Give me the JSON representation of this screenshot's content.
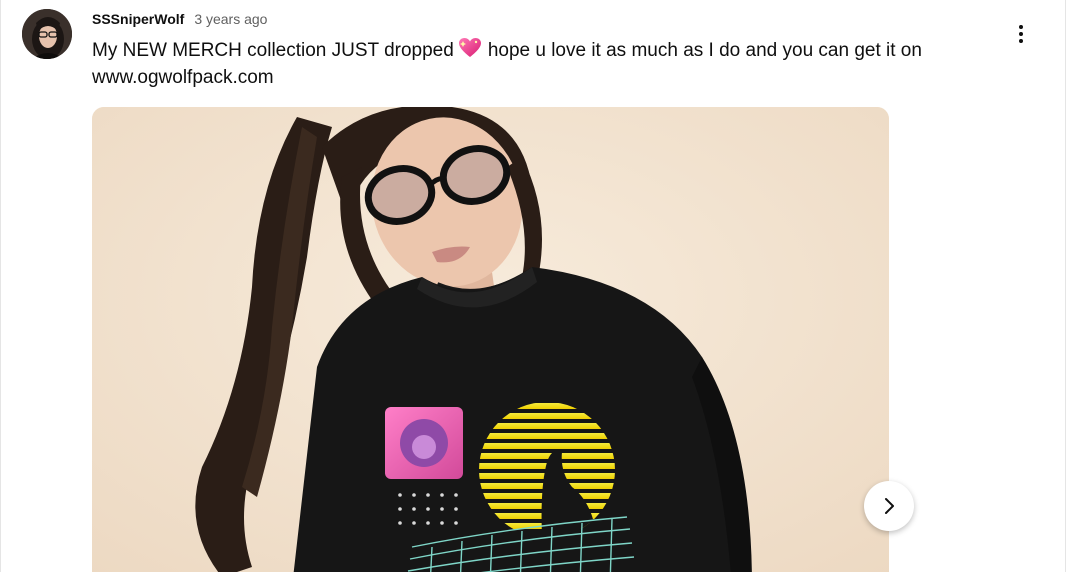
{
  "post": {
    "author": "SSSniperWolf",
    "timestamp": "3 years ago",
    "text_before_emoji": "My NEW MERCH collection JUST dropped",
    "emoji_icon": "sparkling-heart-icon",
    "text_after_emoji": "hope u love it as much as I do and you can get it on www.ogwolfpack.com"
  },
  "icons": {
    "menu": "more-vert-icon",
    "next": "chevron-right-icon"
  },
  "colors": {
    "text_primary": "#0f0f0f",
    "text_secondary": "#606060",
    "heart": "#e8368f"
  }
}
